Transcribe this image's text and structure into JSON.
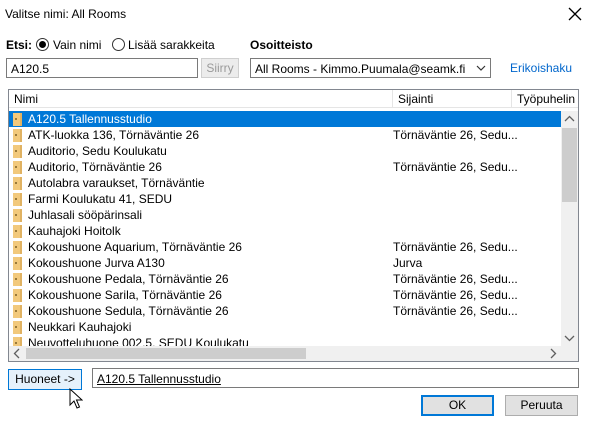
{
  "window": {
    "title": "Valitse nimi: All Rooms"
  },
  "search": {
    "label": "Etsi:",
    "options": [
      {
        "label": "Vain nimi",
        "checked": true
      },
      {
        "label": "Lisää sarakkeita",
        "checked": false
      }
    ],
    "query": "A120.5",
    "go_label": "Siirry"
  },
  "address_book": {
    "label": "Osoitteisto",
    "selected": "All Rooms - Kimmo.Puumala@seamk.fi",
    "advanced_link": "Erikoishaku"
  },
  "grid": {
    "columns": [
      "Nimi",
      "Sijainti",
      "Työpuhelin"
    ],
    "rows": [
      {
        "name": "A120.5 Tallennusstudio",
        "location": "",
        "selected": true
      },
      {
        "name": "ATK-luokka 136, Törnäväntie 26",
        "location": "Törnäväntie 26, Sedu..."
      },
      {
        "name": "Auditorio, Sedu Koulukatu",
        "location": ""
      },
      {
        "name": "Auditorio, Törnäväntie 26",
        "location": "Törnäväntie 26, Sedu..."
      },
      {
        "name": "Autolabra varaukset, Törnäväntie",
        "location": ""
      },
      {
        "name": "Farmi Koulukatu 41, SEDU",
        "location": ""
      },
      {
        "name": "Juhlasali sööpärinsali",
        "location": ""
      },
      {
        "name": "Kauhajoki Hoitolk",
        "location": ""
      },
      {
        "name": "Kokoushuone Aquarium, Törnäväntie 26",
        "location": "Törnäväntie 26, Sedu..."
      },
      {
        "name": "Kokoushuone Jurva A130",
        "location": "Jurva"
      },
      {
        "name": "Kokoushuone Pedala, Törnäväntie 26",
        "location": "Törnäväntie 26, Sedu..."
      },
      {
        "name": "Kokoushuone Sarila, Törnäväntie 26",
        "location": "Törnäväntie 26, Sedu..."
      },
      {
        "name": "Kokoushuone Sedula, Törnäväntie 26",
        "location": "Törnäväntie 26, Sedu..."
      },
      {
        "name": "Neukkari Kauhajoki",
        "location": ""
      },
      {
        "name": "Neuvotteluhuone 002.5, SEDU Koulukatu",
        "location": ""
      }
    ]
  },
  "footer": {
    "rooms_button": "Huoneet ->",
    "rooms_value": "A120.5 Tallennusstudio",
    "ok_label": "OK",
    "cancel_label": "Peruuta"
  },
  "icons": {
    "close": "close-icon",
    "room": "room-icon",
    "dropdown": "chevron-down-icon",
    "cursor": "mouse-pointer-icon"
  },
  "colors": {
    "selection": "#0078d7",
    "link": "#0066cc",
    "room_icon": "#f2c97c"
  }
}
